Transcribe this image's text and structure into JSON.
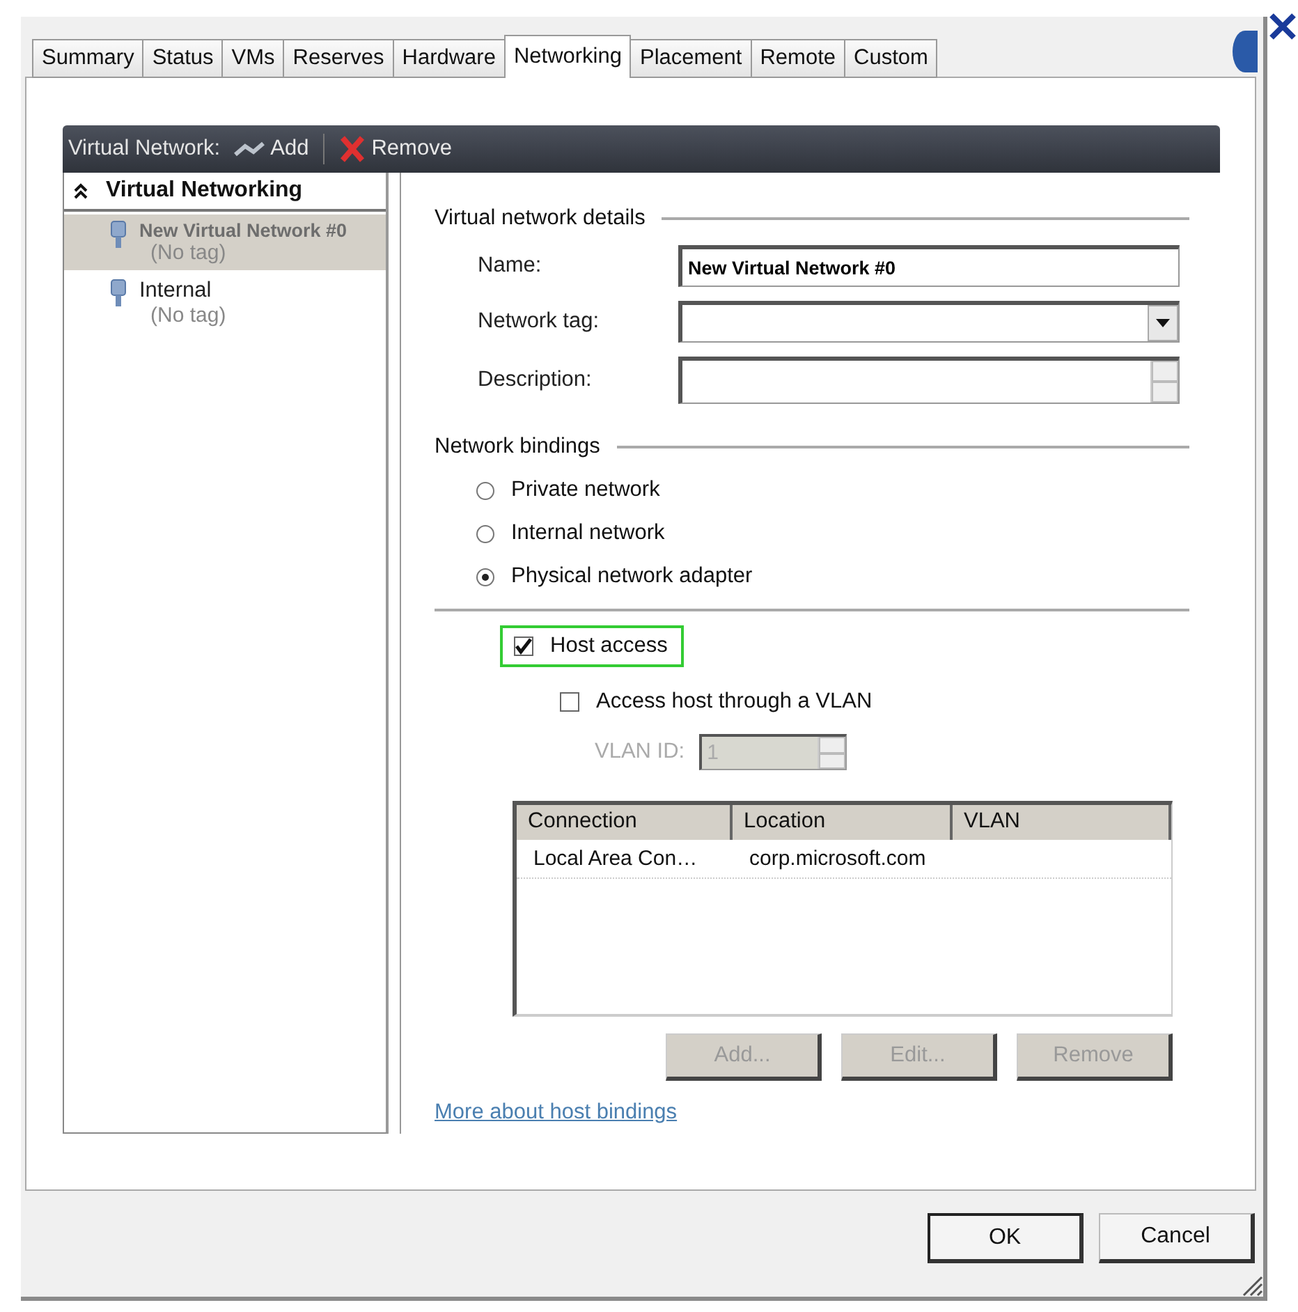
{
  "tabs": [
    {
      "label": "Summary",
      "selected": false
    },
    {
      "label": "Status",
      "selected": false
    },
    {
      "label": "VMs",
      "selected": false
    },
    {
      "label": "Reserves",
      "selected": false
    },
    {
      "label": "Hardware",
      "selected": false
    },
    {
      "label": "Networking",
      "selected": true
    },
    {
      "label": "Placement",
      "selected": false
    },
    {
      "label": "Remote",
      "selected": false
    },
    {
      "label": "Custom",
      "selected": false
    }
  ],
  "toolbar": {
    "label": "Virtual Network:",
    "add": "Add",
    "remove": "Remove"
  },
  "tree": {
    "title": "Virtual Networking",
    "expanded": true,
    "children": [
      {
        "name": "New Virtual Network #0",
        "tag": "(No tag)",
        "selected": true
      },
      {
        "name": "Internal",
        "tag": "(No tag)",
        "selected": false
      }
    ]
  },
  "details": {
    "heading": "Virtual network details",
    "fields": [
      {
        "kind": "text",
        "label": "Name:",
        "value": "New Virtual Network #0"
      },
      {
        "kind": "dropdown",
        "label": "Network tag:"
      },
      {
        "kind": "multiline",
        "label": "Description:"
      }
    ]
  },
  "bindings": {
    "heading": "Network bindings",
    "options": [
      {
        "label": "Private network",
        "selected": false
      },
      {
        "label": "Internal network",
        "selected": false
      },
      {
        "label": "Physical network adapter",
        "selected": true
      }
    ]
  },
  "host_access": {
    "label": "Host access",
    "checked": true,
    "highlighted": true
  },
  "vlan_access": {
    "label": "Access host through a VLAN",
    "checked": false
  },
  "vlan_id": {
    "label": "VLAN ID:",
    "value": "1",
    "disabled": true
  },
  "table": {
    "columns": [
      "Connection",
      "Location",
      "VLAN"
    ],
    "rows": [
      {
        "connection": "Local Area Con…",
        "location": "corp.microsoft.com"
      }
    ]
  },
  "table_buttons": [
    {
      "label": "Add...",
      "disabled": true
    },
    {
      "label": "Edit...",
      "disabled": true
    },
    {
      "label": "Remove",
      "disabled": true
    }
  ],
  "link": "More about host bindings",
  "buttons": [
    {
      "label": "OK",
      "default": true
    },
    {
      "label": "Cancel",
      "default": false
    }
  ]
}
